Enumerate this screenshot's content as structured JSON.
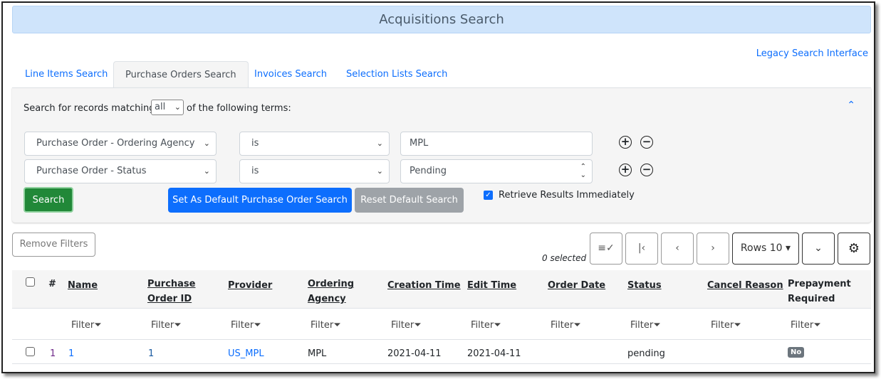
{
  "header": {
    "title": "Acquisitions Search"
  },
  "legacy_link": "Legacy Search Interface",
  "tabs": [
    {
      "label": "Line Items Search"
    },
    {
      "label": "Purchase Orders Search",
      "active": true
    },
    {
      "label": "Invoices Search"
    },
    {
      "label": "Selection Lists Search"
    }
  ],
  "search": {
    "prefix": "Search for records matching",
    "match": "all",
    "suffix": "of the following terms:",
    "rows": [
      {
        "field": "Purchase Order - Ordering Agency",
        "op": "is",
        "value": "MPL"
      },
      {
        "field": "Purchase Order - Status",
        "op": "is",
        "value": "Pending"
      }
    ],
    "search_button": "Search",
    "set_default_button": "Set As Default Purchase Order Search",
    "reset_default_button": "Reset Default Search",
    "retrieve_label": "Retrieve Results Immediately"
  },
  "toolbar": {
    "remove_filters": "Remove Filters",
    "selected": "0 selected",
    "rows": "Rows 10"
  },
  "table": {
    "columns": [
      "#",
      "Name",
      "Purchase Order ID",
      "Provider",
      "Ordering Agency",
      "Creation Time",
      "Edit Time",
      "Order Date",
      "Status",
      "Cancel Reason",
      "Prepayment Required"
    ],
    "filter_label": "Filter",
    "rows": [
      {
        "num": "1",
        "name": "1",
        "po_id": "1",
        "provider": "US_MPL",
        "agency": "MPL",
        "created": "2021-04-11",
        "edited": "2021-04-11",
        "order_date": "",
        "status": "pending",
        "cancel_reason": "",
        "prepayment": "No"
      }
    ]
  },
  "colors": {
    "accent": "#0d6efd",
    "search_green": "#218838",
    "banner": "#cfe4fb"
  }
}
